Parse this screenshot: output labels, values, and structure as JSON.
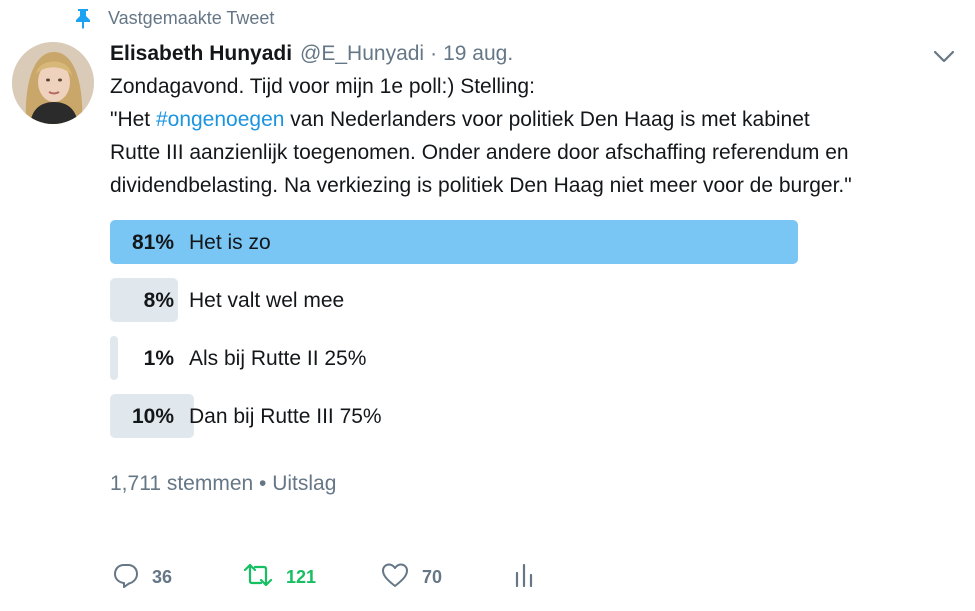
{
  "pinned": {
    "label": "Vastgemaakte Tweet"
  },
  "author": {
    "name": "Elisabeth Hunyadi",
    "handle": "@E_Hunyadi",
    "separator": "·",
    "date": "19 aug."
  },
  "tweet": {
    "lines": [
      "Zondagavond. Tijd voor mijn 1e poll:) Stelling:",
      "van Nederlanders voor politiek Den Haag is met kabinet",
      "Rutte III aanzienlijk toegenomen. Onder andere door afschaffing referendum en",
      "dividendbelasting. Na verkiezing is politiek Den Haag niet meer voor de burger.\""
    ],
    "line2_prefix": "\"Het ",
    "hashtag": "#ongenoegen"
  },
  "poll": {
    "options": [
      {
        "percent_label": "81%",
        "label": "Het is zo",
        "percent": 81,
        "winner": true
      },
      {
        "percent_label": "8%",
        "label": "Het valt wel mee",
        "percent": 8,
        "winner": false
      },
      {
        "percent_label": "1%",
        "label": "Als bij Rutte II 25%",
        "percent": 1,
        "winner": false
      },
      {
        "percent_label": "10%",
        "label": "Dan bij Rutte III 75%",
        "percent": 10,
        "winner": false
      }
    ],
    "meta": "1,711 stemmen • Uitslag"
  },
  "actions": {
    "reply_count": "36",
    "retweet_count": "121",
    "like_count": "70"
  },
  "colors": {
    "accent": "#1b95e0",
    "winner_bar": "#79c6f5",
    "other_bar": "#e1e8ed",
    "retweet": "#17bf63",
    "muted": "#657786"
  }
}
